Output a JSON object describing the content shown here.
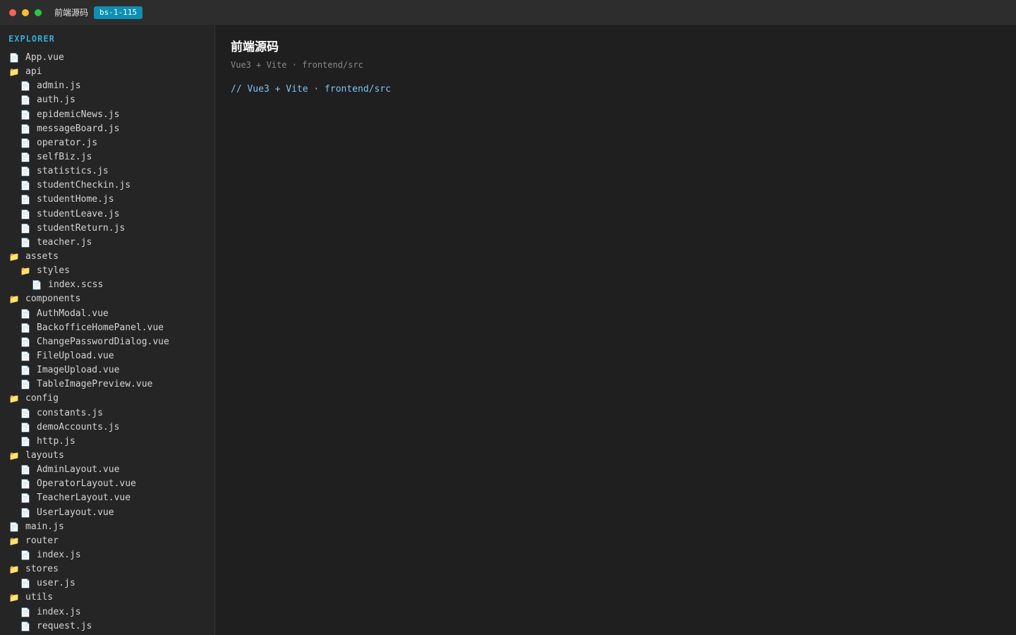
{
  "window": {
    "title": "前端源码",
    "badge": "bs-1-115",
    "badge_color": "#0e8fb5",
    "traffic_lights": [
      "#ff5f57",
      "#febc2e",
      "#28c840"
    ]
  },
  "sidebar": {
    "heading": "EXPLORER",
    "heading_color": "#3aa7d6",
    "items": [
      {
        "label": "App.vue",
        "type": "file",
        "depth": 0
      },
      {
        "label": "api",
        "type": "folder",
        "depth": 0
      },
      {
        "label": "admin.js",
        "type": "file",
        "depth": 1
      },
      {
        "label": "auth.js",
        "type": "file",
        "depth": 1
      },
      {
        "label": "epidemicNews.js",
        "type": "file",
        "depth": 1
      },
      {
        "label": "messageBoard.js",
        "type": "file",
        "depth": 1
      },
      {
        "label": "operator.js",
        "type": "file",
        "depth": 1
      },
      {
        "label": "selfBiz.js",
        "type": "file",
        "depth": 1
      },
      {
        "label": "statistics.js",
        "type": "file",
        "depth": 1
      },
      {
        "label": "studentCheckin.js",
        "type": "file",
        "depth": 1
      },
      {
        "label": "studentHome.js",
        "type": "file",
        "depth": 1
      },
      {
        "label": "studentLeave.js",
        "type": "file",
        "depth": 1
      },
      {
        "label": "studentReturn.js",
        "type": "file",
        "depth": 1
      },
      {
        "label": "teacher.js",
        "type": "file",
        "depth": 1
      },
      {
        "label": "assets",
        "type": "folder",
        "depth": 0
      },
      {
        "label": "styles",
        "type": "folder",
        "depth": 1
      },
      {
        "label": "index.scss",
        "type": "file",
        "depth": 2
      },
      {
        "label": "components",
        "type": "folder",
        "depth": 0
      },
      {
        "label": "AuthModal.vue",
        "type": "file",
        "depth": 1
      },
      {
        "label": "BackofficeHomePanel.vue",
        "type": "file",
        "depth": 1
      },
      {
        "label": "ChangePasswordDialog.vue",
        "type": "file",
        "depth": 1
      },
      {
        "label": "FileUpload.vue",
        "type": "file",
        "depth": 1
      },
      {
        "label": "ImageUpload.vue",
        "type": "file",
        "depth": 1
      },
      {
        "label": "TableImagePreview.vue",
        "type": "file",
        "depth": 1
      },
      {
        "label": "config",
        "type": "folder",
        "depth": 0
      },
      {
        "label": "constants.js",
        "type": "file",
        "depth": 1
      },
      {
        "label": "demoAccounts.js",
        "type": "file",
        "depth": 1
      },
      {
        "label": "http.js",
        "type": "file",
        "depth": 1
      },
      {
        "label": "layouts",
        "type": "folder",
        "depth": 0
      },
      {
        "label": "AdminLayout.vue",
        "type": "file",
        "depth": 1
      },
      {
        "label": "OperatorLayout.vue",
        "type": "file",
        "depth": 1
      },
      {
        "label": "TeacherLayout.vue",
        "type": "file",
        "depth": 1
      },
      {
        "label": "UserLayout.vue",
        "type": "file",
        "depth": 1
      },
      {
        "label": "main.js",
        "type": "file",
        "depth": 0
      },
      {
        "label": "router",
        "type": "folder",
        "depth": 0
      },
      {
        "label": "index.js",
        "type": "file",
        "depth": 1
      },
      {
        "label": "stores",
        "type": "folder",
        "depth": 0
      },
      {
        "label": "user.js",
        "type": "file",
        "depth": 1
      },
      {
        "label": "utils",
        "type": "folder",
        "depth": 0
      },
      {
        "label": "index.js",
        "type": "file",
        "depth": 1
      },
      {
        "label": "request.js",
        "type": "file",
        "depth": 1
      }
    ]
  },
  "icons": {
    "file": "📄",
    "folder": "📁"
  },
  "main": {
    "title": "前端源码",
    "subtitle": "Vue3 + Vite · frontend/src",
    "comment": "// Vue3 + Vite · frontend/src",
    "comment_color": "#7cc4f5"
  }
}
